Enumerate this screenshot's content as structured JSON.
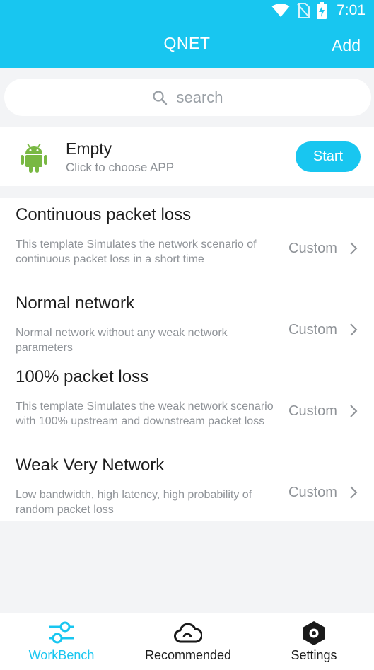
{
  "status_bar": {
    "time": "7:01"
  },
  "header": {
    "title": "QNET",
    "add_label": "Add"
  },
  "search": {
    "placeholder": "search"
  },
  "app_card": {
    "name": "Empty",
    "subtitle": "Click to choose APP",
    "start_label": "Start"
  },
  "templates": [
    {
      "title": "Continuous packet loss",
      "description": "This template Simulates the network scenario of continuous packet loss in a short time",
      "action": "Custom"
    },
    {
      "title": "Normal network",
      "description": "Normal network without any weak network parameters",
      "action": "Custom"
    },
    {
      "title": "100% packet loss",
      "description": "This template Simulates the weak network scenario with 100% upstream and downstream packet loss",
      "action": "Custom"
    },
    {
      "title": "Weak Very Network",
      "description": "Low bandwidth, high latency, high probability of random packet loss",
      "action": "Custom"
    }
  ],
  "bottom_nav": {
    "items": [
      {
        "label": "WorkBench",
        "icon": "sliders-icon",
        "active": true
      },
      {
        "label": "Recommended",
        "icon": "cloud-icon",
        "active": false
      },
      {
        "label": "Settings",
        "icon": "hexagon-gear-icon",
        "active": false
      }
    ]
  },
  "colors": {
    "accent": "#18c6f0",
    "android_green": "#79b843",
    "background": "#f3f4f6"
  }
}
